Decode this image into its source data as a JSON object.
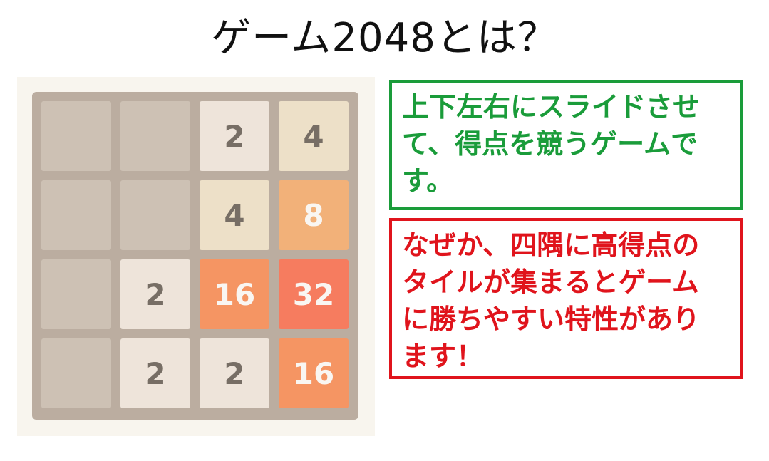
{
  "title": "ゲーム2048とは？",
  "board": {
    "size": 4,
    "rows": [
      [
        0,
        0,
        2,
        4
      ],
      [
        0,
        0,
        4,
        8
      ],
      [
        0,
        2,
        16,
        32
      ],
      [
        0,
        2,
        2,
        16
      ]
    ],
    "tile_colors": {
      "2": "#eee4da",
      "4": "#ede0c8",
      "8": "#f2b179",
      "16": "#f59563",
      "32": "#f67c5f",
      "empty": "#cdc1b4",
      "board": "#bbada0"
    }
  },
  "note_green": {
    "lines": [
      "上下左右にスライドさせ",
      "て、得点を競うゲームで",
      "す。"
    ],
    "color": "#1a9c3a"
  },
  "note_red": {
    "lines": [
      "なぜか、四隅に高得点の",
      "タイルが集まるとゲーム",
      "に勝ちやすい特性があり",
      "ます！"
    ],
    "color": "#e0141c"
  }
}
